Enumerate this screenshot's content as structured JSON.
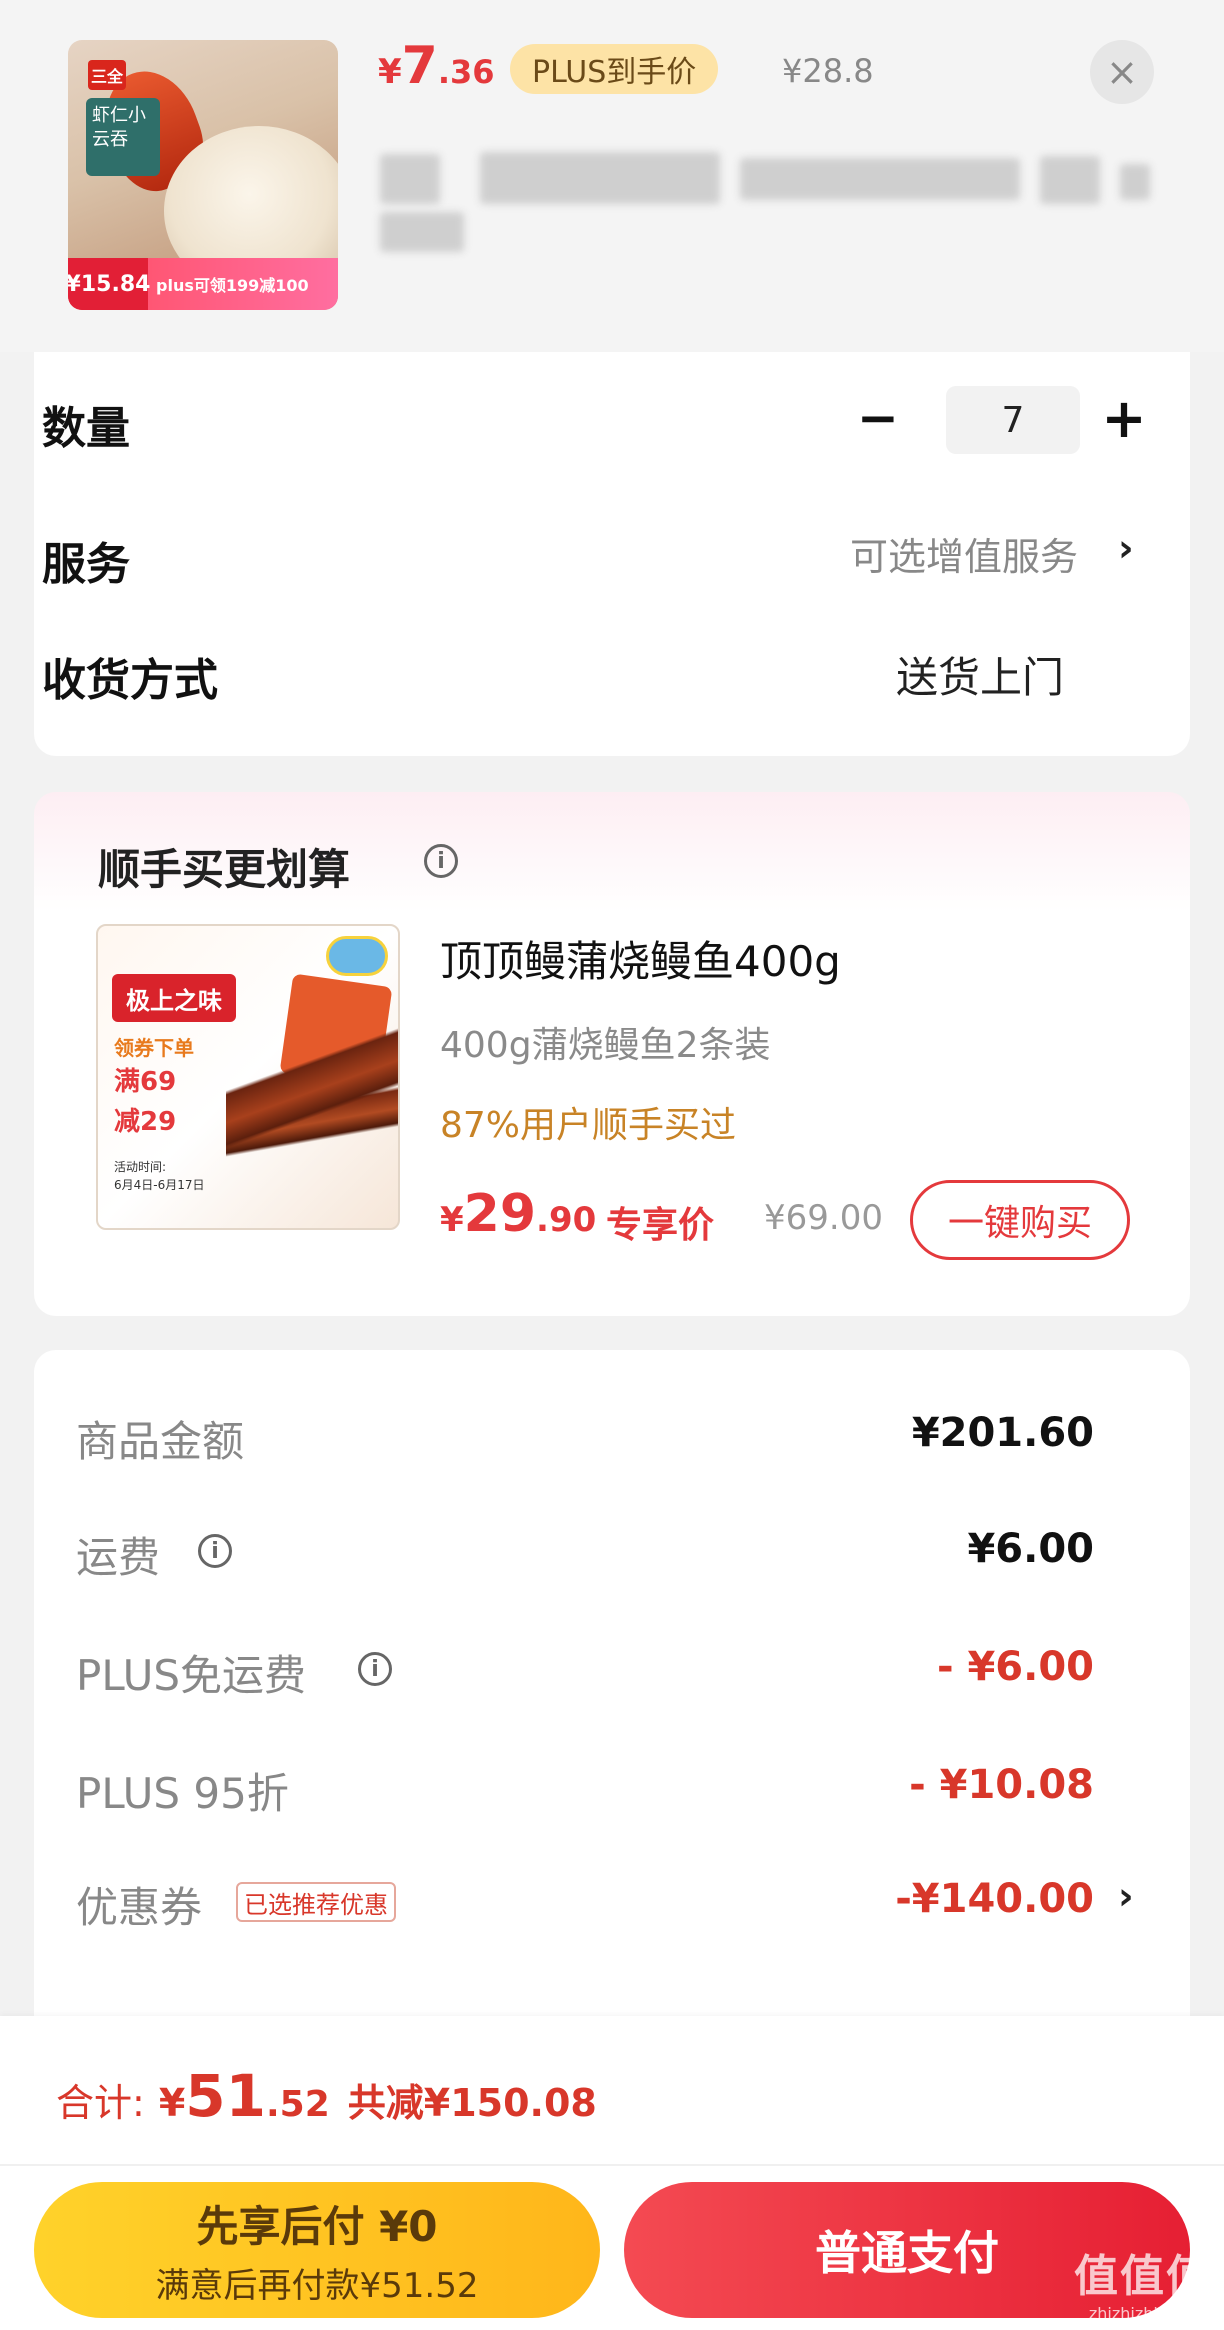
{
  "product": {
    "price_currency": "¥",
    "price_int": "7",
    "price_dec": ".36",
    "plus_badge": "PLUS到手价",
    "original_price": "¥28.8",
    "close_icon": "×",
    "thumbnail": {
      "brand": "三全",
      "box_text": "虾仁小云吞",
      "tag_price": "¥15.84",
      "tag_promo": "plus可领199减100"
    }
  },
  "options": {
    "quantity_label": "数量",
    "quantity_minus": "−",
    "quantity_value": "7",
    "quantity_plus": "+",
    "service_label": "服务",
    "service_value": "可选增值服务",
    "service_chevron": "›",
    "delivery_label": "收货方式",
    "delivery_value": "送货上门"
  },
  "addon": {
    "heading": "顺手买更划算",
    "info_icon": "i",
    "image": {
      "badge": "极上之味",
      "promo_top": "领券下单",
      "promo_line1": "满69",
      "promo_line2": "减29",
      "dates_label": "活动时间:",
      "dates": "6月4日-6月17日"
    },
    "title": "顶顶鳗蒲烧鳗鱼400g",
    "spec": "400g蒲烧鳗鱼2条装",
    "social_proof": "87%用户顺手买过",
    "price_currency": "¥",
    "price_int": "29",
    "price_dec": ".90",
    "price_label": "专享价",
    "original_price": "¥69.00",
    "buy_button": "一键购买"
  },
  "summary": {
    "rows": [
      {
        "label": "商品金额",
        "value": "¥201.60"
      },
      {
        "label": "运费",
        "value": "¥6.00"
      },
      {
        "label": "PLUS免运费",
        "value": "- ¥6.00"
      },
      {
        "label": "PLUS 95折",
        "value": "- ¥10.08"
      },
      {
        "label": "优惠券",
        "value": "-¥140.00"
      }
    ],
    "coupon_tag": "已选推荐优惠",
    "chevron": "›",
    "info_icon": "i"
  },
  "bottom": {
    "total_label": "合计:",
    "total_currency": "¥",
    "total_int": "51",
    "total_dec": ".52",
    "saved_text": "共减¥150.08",
    "pay_later_main": "先享后付 ¥0",
    "pay_later_sub": "满意后再付款¥51.52",
    "pay_normal": "普通支付"
  },
  "watermark": {
    "main": "值值值",
    "sub": "zhizhizhi.com"
  },
  "colors": {
    "accent_red": "#e4393c",
    "plus_gold": "#fde3a6",
    "pay_later_yellow": "#ffc21f",
    "pay_normal_red": "#eb2d3c"
  }
}
